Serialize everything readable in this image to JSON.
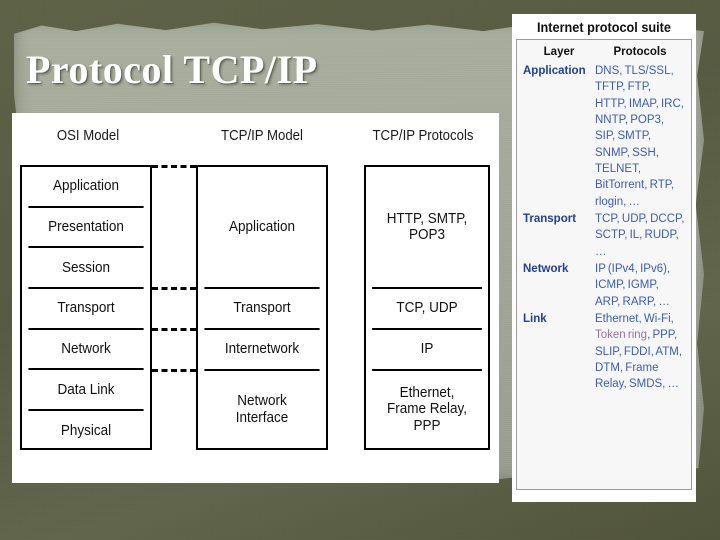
{
  "slide": {
    "title": "Protocol TCP/IP",
    "background_outer_color": "#575b41",
    "background_inner_color": "#a6aa9a",
    "title_color": "#ffffff"
  },
  "diagram": {
    "columns": [
      {
        "heading": "OSI Model"
      },
      {
        "heading": "TCP/IP Model"
      },
      {
        "heading": "TCP/IP Protocols"
      }
    ],
    "osi_layers": [
      "Application",
      "Presentation",
      "Session",
      "Transport",
      "Network",
      "Data Link",
      "Physical"
    ],
    "tcpip_layers": [
      "Application",
      "Transport",
      "Internetwork",
      "Network\nInterface"
    ],
    "tcpip_protocols": [
      "HTTP, SMTP,\nPOP3",
      "TCP, UDP",
      "IP",
      "Ethernet,\nFrame Relay,\nPPP"
    ]
  },
  "wiki": {
    "title": "Internet protocol suite",
    "header_layer": "Layer",
    "header_protocols": "Protocols",
    "link_color": "#3a5bbf",
    "layer_color": "#20409a",
    "visited_link_color": "#9a6ea8",
    "rows": [
      {
        "layer": "Application",
        "protocols": "DNS, TLS/SSL, TFTP, FTP, HTTP, IMAP, IRC, NNTP, POP3, SIP, SMTP, SNMP, SSH, TELNET, BitTorrent, RTP, rlogin, …"
      },
      {
        "layer": "Transport",
        "protocols": "TCP, UDP, DCCP, SCTP, IL, RUDP, …"
      },
      {
        "layer": "Network",
        "protocols": "IP (IPv4, IPv6), ICMP, IGMP, ARP, RARP, …"
      },
      {
        "layer": "Link",
        "protocols_pre": "Ethernet, Wi-Fi, ",
        "protocols_visited": "Token ring",
        "protocols_post": ", PPP, SLIP, FDDI, ATM, DTM, Frame Relay, SMDS, …"
      }
    ]
  }
}
